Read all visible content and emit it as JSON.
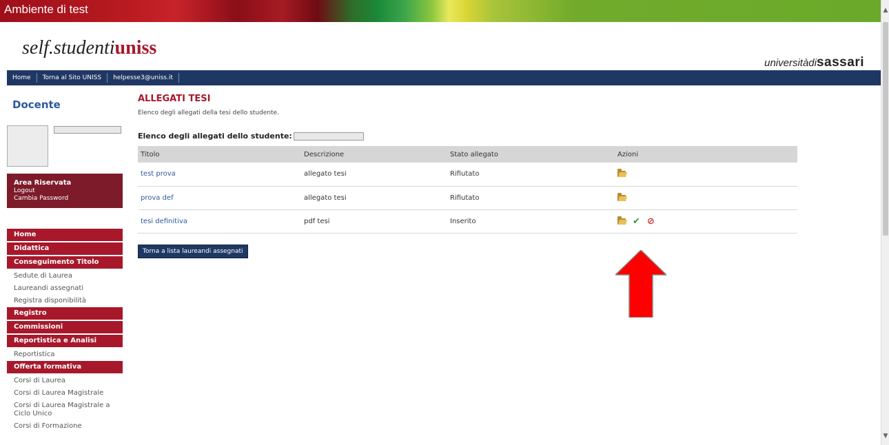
{
  "env_banner": {
    "title": "Ambiente di test"
  },
  "header": {
    "brand_prefix": "self.studenti",
    "brand_suffix": "uniss",
    "uni_prefix": "universitàdi",
    "uni_suffix": "sassari"
  },
  "topnav": {
    "items": [
      "Home",
      "Torna al Sito UNISS",
      "helpesse3@uniss.it"
    ]
  },
  "sidebar": {
    "title": "Docente",
    "reserved": {
      "heading": "Area Riservata",
      "logout": "Logout",
      "change_password": "Cambia Password"
    },
    "menu": [
      {
        "type": "header",
        "label": "Home"
      },
      {
        "type": "header",
        "label": "Didattica"
      },
      {
        "type": "header",
        "label": "Conseguimento Titolo"
      },
      {
        "type": "item",
        "label": "Sedute di Laurea"
      },
      {
        "type": "item",
        "label": "Laureandi assegnati"
      },
      {
        "type": "item",
        "label": "Registra disponibilità"
      },
      {
        "type": "header",
        "label": "Registro"
      },
      {
        "type": "header",
        "label": "Commissioni"
      },
      {
        "type": "header",
        "label": "Reportistica e Analisi"
      },
      {
        "type": "item",
        "label": "Reportistica"
      },
      {
        "type": "header",
        "label": "Offerta formativa"
      },
      {
        "type": "item",
        "label": "Corsi di Laurea"
      },
      {
        "type": "item",
        "label": "Corsi di Laurea Magistrale"
      },
      {
        "type": "item",
        "label": "Corsi di Laurea Magistrale a Ciclo Unico"
      },
      {
        "type": "item",
        "label": "Corsi di Formazione"
      }
    ]
  },
  "main": {
    "title": "ALLEGATI TESI",
    "description": "Elenco degli allegati della tesi dello studente.",
    "list_heading": "Elenco degli allegati dello studente:",
    "table": {
      "columns": [
        "Titolo",
        "Descrizione",
        "Stato allegato",
        "Azioni"
      ],
      "rows": [
        {
          "title": "test prova",
          "description": "allegato tesi",
          "status": "Rifiutato",
          "actions": [
            "folder-icon"
          ]
        },
        {
          "title": "prova def",
          "description": "allegato tesi",
          "status": "Rifiutato",
          "actions": [
            "folder-icon"
          ]
        },
        {
          "title": "tesi definitiva",
          "description": "pdf tesi",
          "status": "Inserito",
          "actions": [
            "folder-icon",
            "approve-icon",
            "reject-icon"
          ]
        }
      ]
    },
    "back_button": "Torna a lista laureandi assegnati"
  },
  "colors": {
    "accent_red": "#a7182b",
    "nav_blue": "#1f3763",
    "link_blue": "#2d58a0",
    "arrow_red": "#ff0000"
  }
}
